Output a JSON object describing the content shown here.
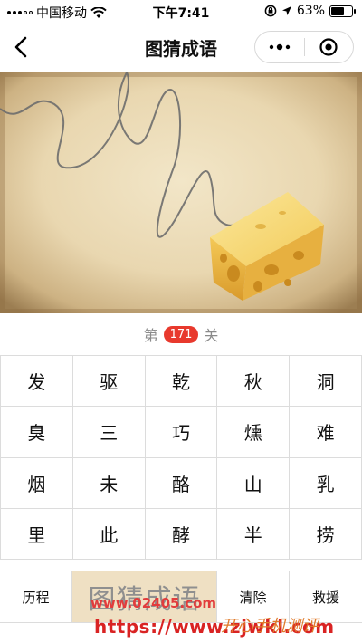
{
  "status_bar": {
    "carrier": "中国移动",
    "time": "下午7:41",
    "battery_percent": "63%",
    "battery_level": 0.63,
    "icons": [
      "signal-dots-icon",
      "wifi-icon",
      "rotation-lock-icon",
      "location-arrow-icon",
      "battery-icon"
    ]
  },
  "nav": {
    "title": "图猜成语",
    "back_icon": "chevron-left-icon",
    "more_icon": "more-dots-icon",
    "close_icon": "target-circle-icon"
  },
  "puzzle": {
    "description_icon": "cheese-with-string-image"
  },
  "level": {
    "prefix": "第",
    "number": "171",
    "suffix": "关",
    "badge_color": "#e8392d"
  },
  "grid": {
    "rows": [
      [
        "发",
        "驱",
        "乾",
        "秋",
        "洞"
      ],
      [
        "臭",
        "三",
        "巧",
        "燻",
        "难"
      ],
      [
        "烟",
        "未",
        "酪",
        "山",
        "乳"
      ],
      [
        "里",
        "此",
        "酵",
        "半",
        "捞"
      ]
    ]
  },
  "bottom": {
    "history_label": "历程",
    "answer_label": "图猜成语",
    "clear_label": "清除",
    "help_label": "救援",
    "answer_bg": "#efe0c3"
  },
  "watermark": {
    "url_top": "www.02405.com",
    "url_bottom": "https://www.zjwkl.com",
    "cn_text": "开心手机测评"
  }
}
